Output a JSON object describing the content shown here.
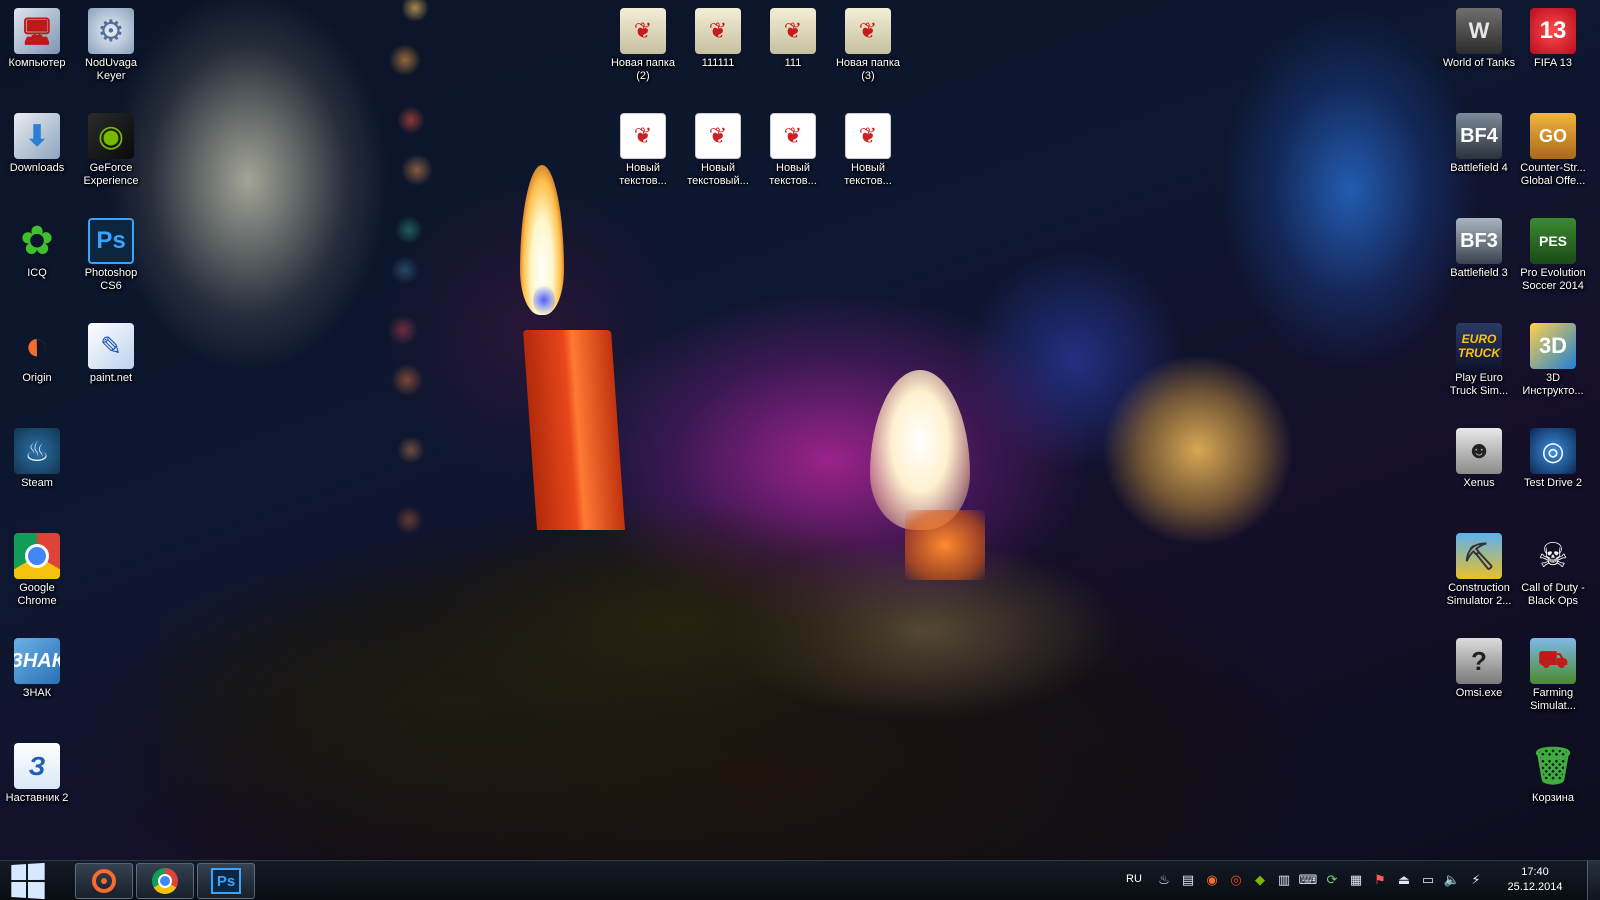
{
  "desktop": {
    "left_icons": [
      {
        "label": "Компьютер",
        "icon": "computer-icon",
        "glyph": "🖥"
      },
      {
        "label": "NodUvaga Keyer",
        "icon": "gear-icon",
        "glyph": "⚙"
      },
      {
        "label": "Downloads",
        "icon": "downloads-folder-icon",
        "glyph": "⬇"
      },
      {
        "label": "GeForce Experience",
        "icon": "nvidia-icon",
        "glyph": "◉"
      },
      {
        "label": "ICQ",
        "icon": "icq-flower-icon",
        "glyph": "✿"
      },
      {
        "label": "Photoshop CS6",
        "icon": "photoshop-icon",
        "glyph": "Ps"
      },
      {
        "label": "Origin",
        "icon": "origin-icon",
        "glyph": "◐"
      },
      {
        "label": "paint.net",
        "icon": "paint-net-icon",
        "glyph": "✎"
      },
      {
        "label": "Steam",
        "icon": "steam-icon",
        "glyph": "♨"
      },
      {
        "label": "Google Chrome",
        "icon": "chrome-icon",
        "glyph": ""
      },
      {
        "label": "ЗНАК",
        "icon": "znak-icon",
        "glyph": "ЗНАК"
      },
      {
        "label": "Наставник 2",
        "icon": "kursy-icon",
        "glyph": "З"
      }
    ],
    "center_icons": [
      {
        "label": "Новая папка (2)",
        "icon": "folder-icon",
        "glyph": "❦"
      },
      {
        "label": "111111",
        "icon": "folder-icon",
        "glyph": "❦"
      },
      {
        "label": "111",
        "icon": "folder-icon",
        "glyph": "❦"
      },
      {
        "label": "Новая папка (3)",
        "icon": "folder-icon",
        "glyph": "❦"
      },
      {
        "label": "Новый текстов...",
        "icon": "text-document-icon",
        "glyph": "❦"
      },
      {
        "label": "Новый текстовый...",
        "icon": "text-document-icon",
        "glyph": "❦"
      },
      {
        "label": "Новый текстов...",
        "icon": "text-document-icon",
        "glyph": "❦"
      },
      {
        "label": "Новый текстов...",
        "icon": "text-document-icon",
        "glyph": "❦"
      }
    ],
    "right_icons": [
      {
        "label": "World of Tanks",
        "icon": "world-of-tanks-icon",
        "glyph": "W"
      },
      {
        "label": "FIFA 13",
        "icon": "fifa-13-icon",
        "glyph": "13"
      },
      {
        "label": "Battlefield 4",
        "icon": "battlefield-4-icon",
        "glyph": "BF4"
      },
      {
        "label": "Counter-Str... Global Offe...",
        "icon": "csgo-icon",
        "glyph": "GO"
      },
      {
        "label": "Battlefield 3",
        "icon": "battlefield-3-icon",
        "glyph": "BF3"
      },
      {
        "label": "Pro Evolution Soccer 2014",
        "icon": "pes-2014-icon",
        "glyph": "PES"
      },
      {
        "label": "Play Euro Truck Sim...",
        "icon": "euro-truck-icon",
        "glyph": "EURO TRUCK"
      },
      {
        "label": "3D Инструкто...",
        "icon": "3d-instructor-icon",
        "glyph": "3D"
      },
      {
        "label": "Xenus",
        "icon": "xenus-icon",
        "glyph": "☻"
      },
      {
        "label": "Test Drive 2",
        "icon": "test-drive-icon",
        "glyph": "◎"
      },
      {
        "label": "Construction Simulator 2...",
        "icon": "crane-icon",
        "glyph": "⛏"
      },
      {
        "label": "Call of Duty - Black Ops",
        "icon": "call-of-duty-icon",
        "glyph": "☠"
      },
      {
        "label": "Omsi.exe",
        "icon": "omsi-bus-icon",
        "glyph": "?"
      },
      {
        "label": "Farming Simulat...",
        "icon": "farming-tractor-icon",
        "glyph": "⛟"
      },
      {
        "label": "Корзина",
        "icon": "recycle-bin-icon",
        "glyph": "🗑"
      }
    ]
  },
  "taskbar": {
    "pinned": [
      {
        "name": "origin",
        "icon": "origin-icon"
      },
      {
        "name": "chrome",
        "icon": "chrome-icon"
      },
      {
        "name": "photoshop",
        "icon": "photoshop-icon",
        "glyph": "Ps"
      }
    ],
    "language": "RU",
    "tray_icons": [
      {
        "icon": "steam-tray-icon",
        "glyph": "♨"
      },
      {
        "icon": "network-tray-icon",
        "glyph": "▤"
      },
      {
        "icon": "origin-tray-icon",
        "glyph": "◉"
      },
      {
        "icon": "antivirus-tray-icon",
        "glyph": "◎"
      },
      {
        "icon": "nvidia-tray-icon",
        "glyph": "◆"
      },
      {
        "icon": "monitor-tray-icon",
        "glyph": "▥"
      },
      {
        "icon": "keyboard-tray-icon",
        "glyph": "⌨"
      },
      {
        "icon": "sync-tray-icon",
        "glyph": "⟳"
      },
      {
        "icon": "printer-tray-icon",
        "glyph": "▦"
      },
      {
        "icon": "action-center-tray-icon",
        "glyph": "⚑"
      },
      {
        "icon": "usb-tray-icon",
        "glyph": "⏏"
      },
      {
        "icon": "display-tray-icon",
        "glyph": "▭"
      },
      {
        "icon": "volume-tray-icon",
        "glyph": "🔈"
      },
      {
        "icon": "power-tray-icon",
        "glyph": "⚡"
      }
    ],
    "clock": {
      "time": "17:40",
      "date": "25.12.2014"
    }
  }
}
